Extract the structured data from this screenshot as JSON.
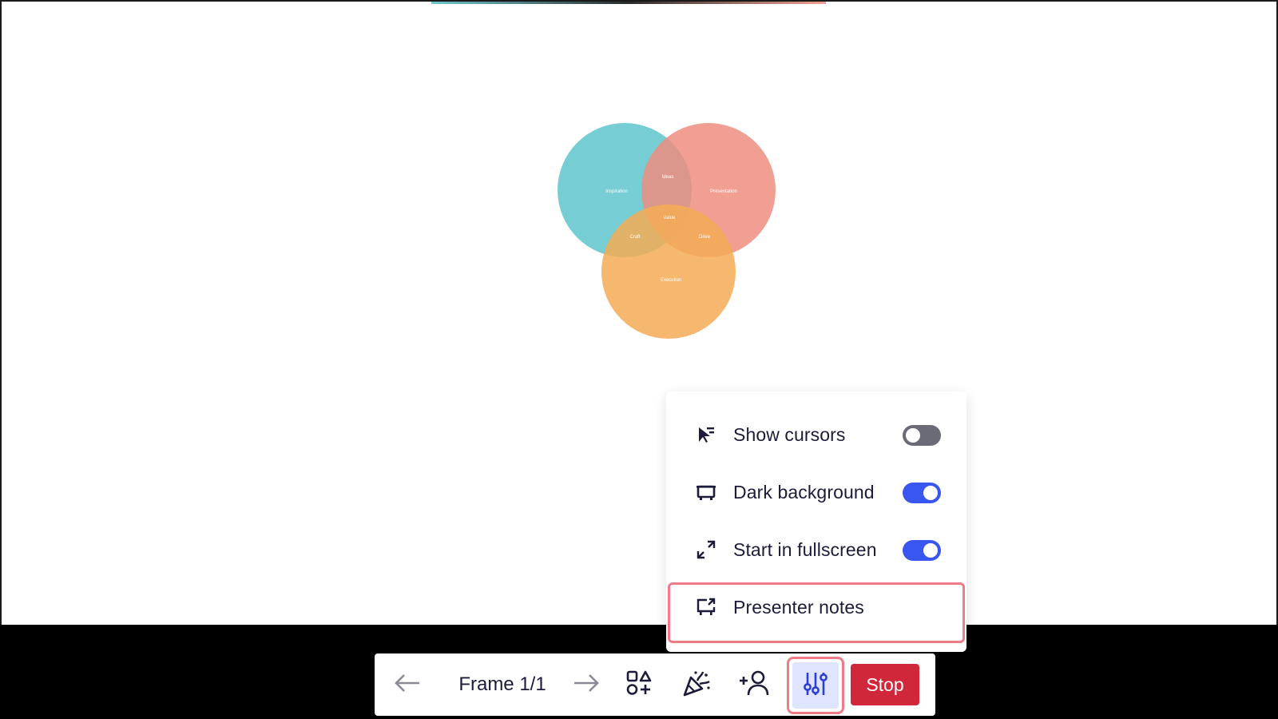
{
  "canvas": {
    "venn_labels": {
      "left": "Inspiration",
      "right": "Presentation",
      "bottom": "Execution",
      "top_overlap": "Ideas",
      "center": "Value",
      "left_overlap": "Craft",
      "right_overlap": "Drive"
    },
    "colors": {
      "left_circle": "#5ec4cc",
      "right_circle": "#ef8d80",
      "bottom_circle": "#f5ac55"
    }
  },
  "settings_menu": {
    "items": [
      {
        "label": "Show cursors",
        "icon": "cursor-icon",
        "toggle": false
      },
      {
        "label": "Dark background",
        "icon": "monitor-icon",
        "toggle": true
      },
      {
        "label": "Start in fullscreen",
        "icon": "expand-icon",
        "toggle": true
      },
      {
        "label": "Presenter notes",
        "icon": "external-screen-icon"
      }
    ]
  },
  "toolbar": {
    "frame_label": "Frame 1/1",
    "prev_icon": "arrow-left-icon",
    "next_icon": "arrow-right-icon",
    "shapes_icon": "shapes-add-icon",
    "celebrate_icon": "party-popper-icon",
    "invite_icon": "add-person-icon",
    "settings_icon": "sliders-icon",
    "stop_label": "Stop",
    "stop_color": "#d0273a",
    "highlight_color": "#ef7b86"
  }
}
